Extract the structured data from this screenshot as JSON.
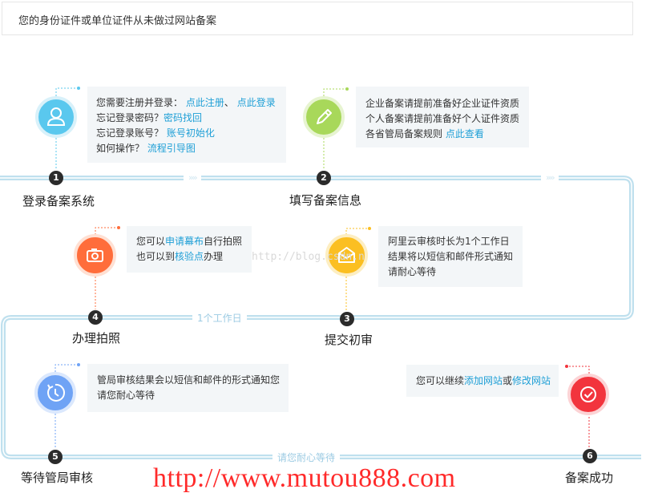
{
  "header": {
    "text": "您的身份证件或单位证件从未做过网站备案"
  },
  "steps": [
    {
      "num": "1",
      "label": "登录备案系统"
    },
    {
      "num": "2",
      "label": "填写备案信息"
    },
    {
      "num": "3",
      "label": "提交初审"
    },
    {
      "num": "4",
      "label": "办理拍照"
    },
    {
      "num": "5",
      "label": "等待管局审核"
    },
    {
      "num": "6",
      "label": "备案成功"
    }
  ],
  "card1": {
    "l1_text": "您需要注册并登录：",
    "l1_link1": "点此注册",
    "l1_sep": "、",
    "l1_link2": "点此登录",
    "l2_text": "忘记登录密码？",
    "l2_link": "密码找回",
    "l3_text": "忘记登录账号？",
    "l3_link": "账号初始化",
    "l4_text": "如何操作？",
    "l4_link": "流程引导图"
  },
  "card2": {
    "l1": "企业备案请提前准备好企业证件资质",
    "l2": "个人备案请提前准备好个人证件资质",
    "l3_text": "各省管局备案规则",
    "l3_link": "点此查看"
  },
  "card3": {
    "l1": "阿里云审核时长为1个工作日",
    "l2": "结果将以短信和邮件形式通知",
    "l3": "请耐心等待"
  },
  "card4": {
    "l1_text": "您可以",
    "l1_link": "申请幕布",
    "l1_after": "自行拍照",
    "l2_text": "也可以到",
    "l2_link": "核验点",
    "l2_after": "办理"
  },
  "card5": {
    "l1": "管局审核结果会以短信和邮件的形式通知您",
    "l2": "请您耐心等待"
  },
  "card6": {
    "text1": "您可以继续",
    "link1": "添加网站",
    "text2": "或",
    "link2": "修改网站"
  },
  "track": {
    "label_mid": "1个工作日",
    "label_bottom": "请您耐心等待",
    "chevrons": "››››"
  },
  "watermark": {
    "text": "http://blog.csdn.n"
  },
  "footer_url": {
    "text": "http://www.mutou888.com"
  },
  "colors": {
    "track": "#bfe0ee",
    "blue": "#5ac8ee",
    "green": "#a8d85a",
    "orange_red": "#ff6d3b",
    "yellow": "#fbbf22",
    "periwinkle": "#6fa3f5",
    "red": "#f2343d",
    "link": "#1e9fd6"
  }
}
